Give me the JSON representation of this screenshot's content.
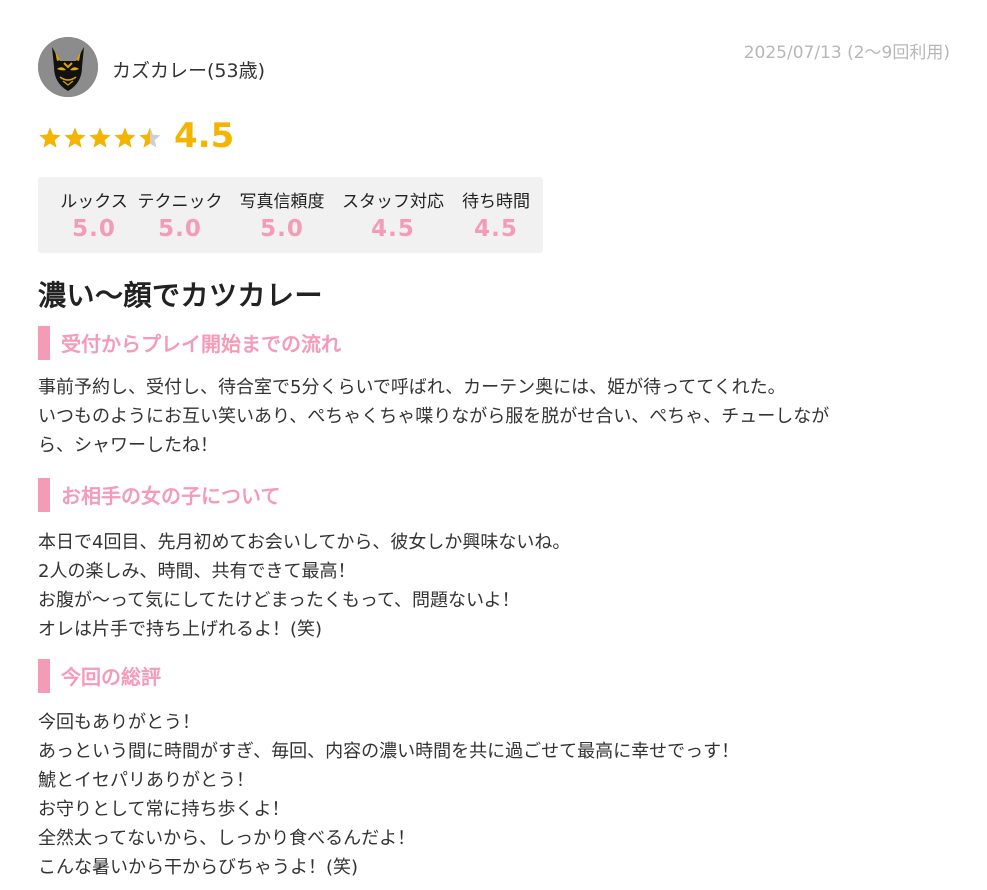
{
  "reviewer": {
    "avatar_icon": "fox-mask-icon",
    "name": "カズカレー(53歳)",
    "date": "2025/07/13 (2〜9回利用)"
  },
  "rating": {
    "stars": 4.5,
    "score": "4.5",
    "star_color": "#f5b400"
  },
  "subscores": [
    {
      "label": "ルックス",
      "value": "5.0"
    },
    {
      "label": "テクニック",
      "value": "5.0"
    },
    {
      "label": "写真信頼度",
      "value": "5.0"
    },
    {
      "label": "スタッフ対応",
      "value": "4.5"
    },
    {
      "label": "待ち時間",
      "value": "4.5"
    }
  ],
  "title": "濃い〜顔でカツカレー",
  "accent_color": "#f49bb8",
  "sections": [
    {
      "heading": "受付からプレイ開始までの流れ",
      "lines": [
        "事前予約し、受付し、待合室で5分くらいで呼ばれ、カーテン奥には、姫が待っててくれた。",
        "いつものようにお互い笑いあり、ぺちゃくちゃ喋りながら服を脱がせ合い、ぺちゃ、チューしなが",
        "ら、シャワーしたね！"
      ]
    },
    {
      "heading": "お相手の女の子について",
      "lines": [
        "本日で4回目、先月初めてお会いしてから、彼女しか興味ないね。",
        "2人の楽しみ、時間、共有できて最高！",
        "お腹が〜って気にしてたけどまったくもって、問題ないよ！",
        "オレは片手で持ち上げれるよ！(笑)"
      ]
    },
    {
      "heading": "今回の総評",
      "lines": [
        "今回もありがとう！",
        "あっという間に時間がすぎ、毎回、内容の濃い時間を共に過ごせて最高に幸せでっす！",
        "鯱とイセパリありがとう！",
        "お守りとして常に持ち歩くよ！",
        "全然太ってないから、しっかり食べるんだよ！",
        "こんな暑いから干からびちゃうよ！(笑)"
      ]
    }
  ]
}
